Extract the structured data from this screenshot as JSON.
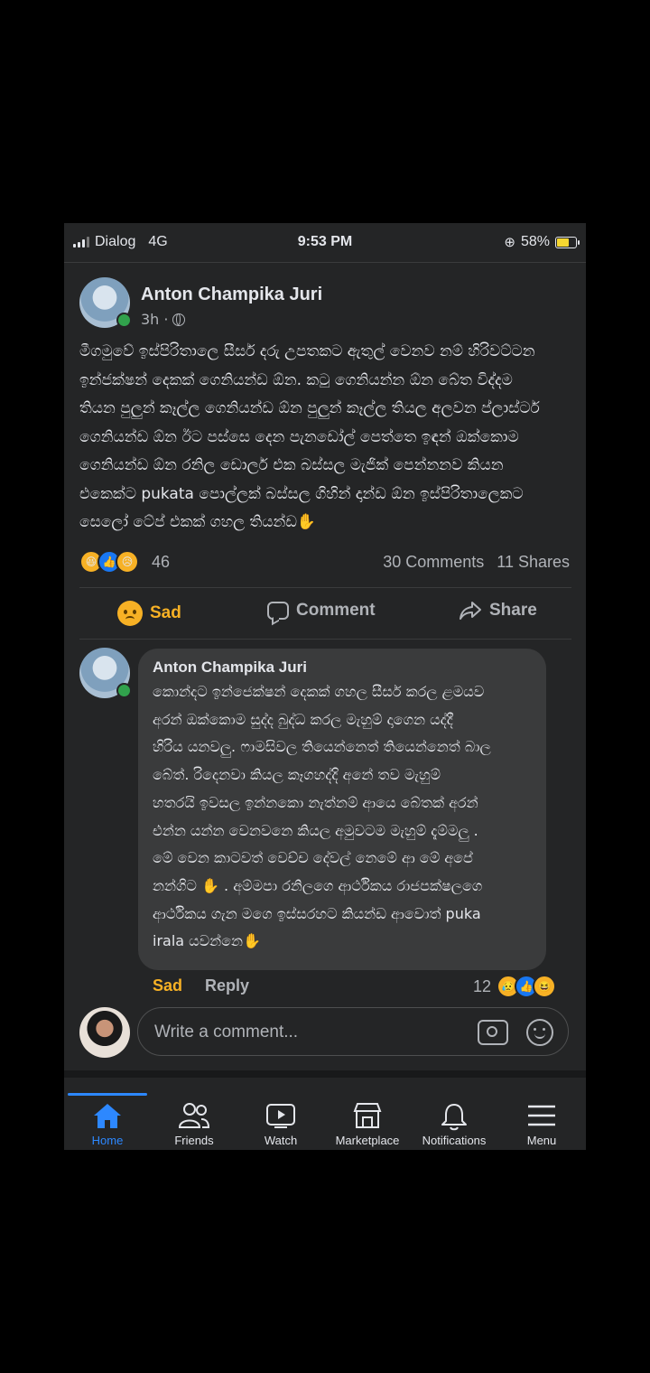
{
  "status_bar": {
    "carrier": "Dialog",
    "network": "4G",
    "time": "9:53 PM",
    "battery": "58%",
    "icons": [
      "signal-bars-icon",
      "orientation-lock-icon",
      "battery-charging-icon"
    ]
  },
  "post": {
    "author": "Anton Champika Juri",
    "time": "3h",
    "separator": "·",
    "privacy_icon": "globe-icon",
    "body": "මීගමුවේ ඉස්පිරිතාලෙ සීසර් දරු උපතකට ඇතුල් වෙනව නම් හිරිවට්ටන\nඉන්ජක්ෂන් දෙකක් ගෙනියන්ඩ ඕන. කටු ගෙනියන්න ඕන බේත විද්දම\nතියන පුලුන් කෑල්ල ගෙනියන්ඩ ඕන පුලුන් කෑල්ල තියල අලවන ප්ලාස්ටර්\nගෙනියන්ඩ ඕන ඊට පස්සෙ දෙන පැනඩෝල් පෙත්තෙ ඉඳන් ඔක්කොම\nගෙනියන්ඩ ඕන රනිල ඩොලර් එක බස්සල මැජික් පෙන්නනව කියන\nඑකෙක්ට pukata පොල්ලක් බස්සල ගිහින් දාන්ඩ ඕන ඉස්පිරිතාලෙකට\nසෙලෝ ටේප් එකක් ගහල තියන්ඩ✋",
    "reaction_count": "46",
    "reaction_icons": [
      "haha-icon",
      "like-icon",
      "sad-icon"
    ],
    "comments_label": "30 Comments",
    "shares_label": "11 Shares"
  },
  "actions": {
    "react_label": "Sad",
    "comment_label": "Comment",
    "share_label": "Share"
  },
  "comment": {
    "author": "Anton Champika Juri",
    "text": "කොන්දට ඉන්ජෙක්ෂන් දෙකක් ගහල සීසර් කරල ළමයව\nඅරන් ඔක්කොම සුද්ද බුද්ධ කරල මැහුම් දාගෙන යද්දී\nහිරිය යනවලු. ෆාමසිවල තියෙන්නෙත් තියෙන්නෙත් බාල\nබේත්. රිදෙනවා කියල කෑගහද්දි අනේ තව මැහුම්\nහතරයි ඉවසල ඉන්නකො නැත්නම් ආයෙ බේතක් අරන්\nඑන්න යන්න වෙනවනෙ කියල අමුවටම මැහුම් දැම්මලු .\nමේ වෙන කාටවත් වෙච්ච දේවල් නෙමේ ආ මේ අපේ\nනන්ගිට ✋ . අම්මපා රනිලගෙ ආර්ථිකය රාජපක්ෂලගෙ\nආර්ථිකය ගැන මගෙ ඉස්සරහට කියන්ඩ ආවොත් puka\nirala යවන්නෙ✋",
    "react_label": "Sad",
    "reply_label": "Reply",
    "reaction_count": "12",
    "reaction_icons": [
      "sad-icon",
      "like-icon",
      "haha-icon"
    ]
  },
  "composer": {
    "placeholder": "Write a comment...",
    "icons": [
      "camera-icon",
      "smiley-icon"
    ]
  },
  "tabbar": {
    "tabs": [
      {
        "label": "Home",
        "icon": "home-icon",
        "active": true
      },
      {
        "label": "Friends",
        "icon": "friends-icon",
        "active": false
      },
      {
        "label": "Watch",
        "icon": "watch-icon",
        "active": false
      },
      {
        "label": "Marketplace",
        "icon": "marketplace-icon",
        "active": false
      },
      {
        "label": "Notifications",
        "icon": "bell-icon",
        "active": false
      },
      {
        "label": "Menu",
        "icon": "menu-icon",
        "active": false
      }
    ]
  },
  "colors": {
    "background": "#242526",
    "comment_bubble": "#3a3b3c",
    "accent_blue": "#2d88ff",
    "sad_yellow": "#f7b125",
    "online_green": "#31a24c"
  }
}
